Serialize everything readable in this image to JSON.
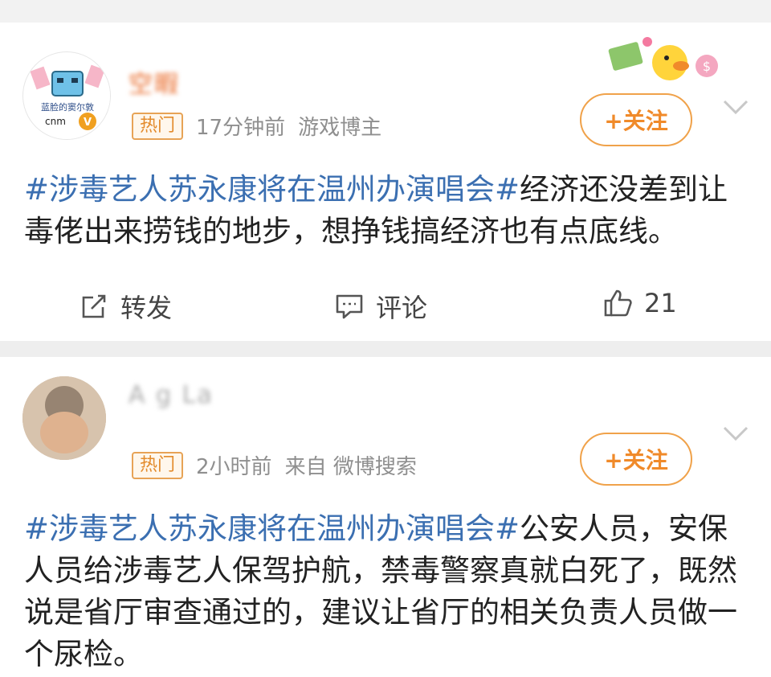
{
  "posts": [
    {
      "username": "空暇",
      "badge": "热门",
      "time": "17分钟前",
      "source": "游戏博主",
      "follow_label": "+关注",
      "avatar_text": "蓝脸的窦尔敦",
      "avatar_sub": "cnm",
      "hashtag": "#涉毒艺人苏永康将在温州办演唱会#",
      "body": "经济还没差到让毒佬出来捞钱的地步，想挣钱搞经济也有点底线。",
      "actions": {
        "repost": "转发",
        "comment": "评论",
        "like": "21"
      }
    },
    {
      "username": "A g La",
      "badge": "热门",
      "time": "2小时前",
      "source": "来自 微博搜索",
      "follow_label": "+关注",
      "hashtag": "#涉毒艺人苏永康将在温州办演唱会#",
      "body": "公安人员，安保人员给涉毒艺人保驾护航，禁毒警察真就白死了，既然说是省厅审查通过的，建议让省厅的相关负责人员做一个尿检。"
    }
  ],
  "icons": {
    "repost": "edit-share-icon",
    "comment": "comment-bubble-icon",
    "like": "thumbs-up-icon",
    "more": "chevron-down-icon",
    "verified": "verified-v-icon"
  },
  "colors": {
    "accent": "#f08a2a",
    "hashtag": "#3b6fb1",
    "hot_badge": "#e38b2c"
  }
}
